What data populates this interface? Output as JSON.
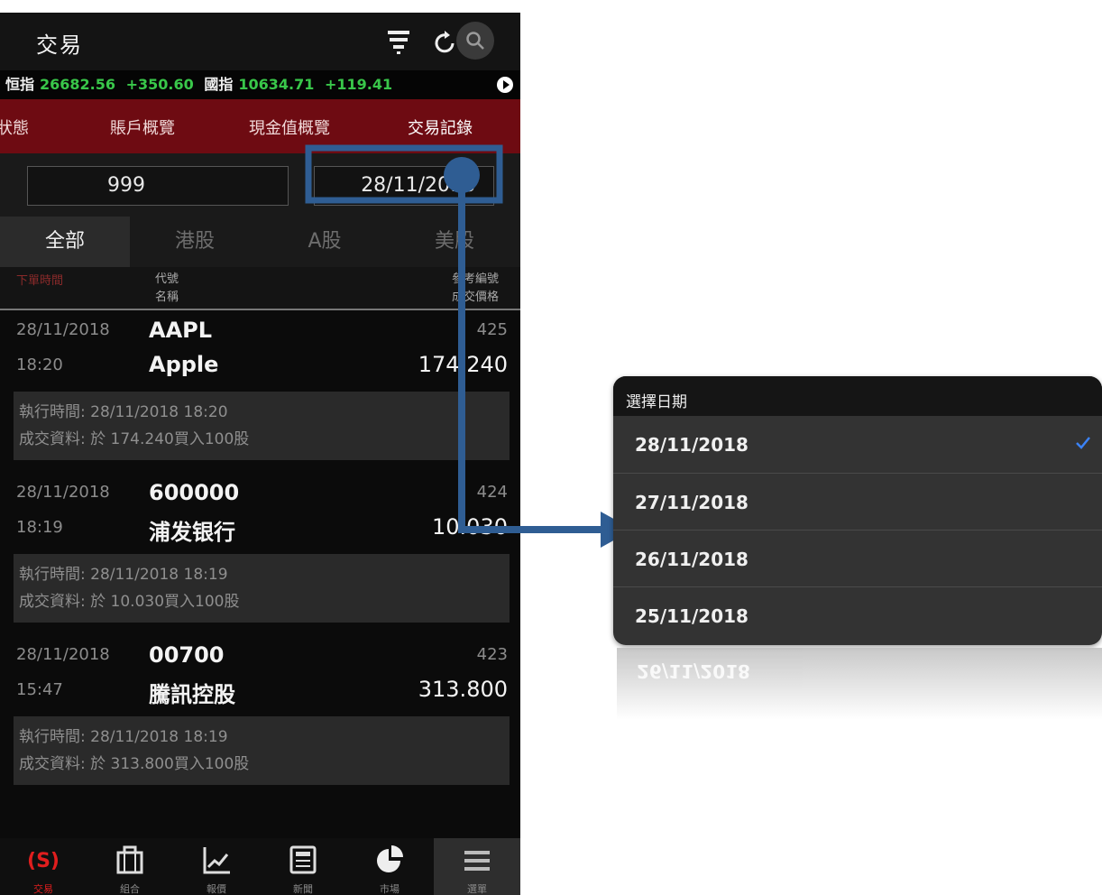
{
  "header": {
    "title": "交易",
    "icons": [
      "filter-icon",
      "refresh-icon",
      "search-icon"
    ]
  },
  "ticker": [
    {
      "name": "恒指",
      "value": "26682.56",
      "change": "+350.60"
    },
    {
      "name": "國指",
      "value": "10634.71",
      "change": "+119.41"
    }
  ],
  "nav_tabs": [
    "狀態",
    "賬戶概覽",
    "現金值概覽",
    "交易記錄"
  ],
  "filters": {
    "account": "999",
    "date": "28/11/2018"
  },
  "market_tabs": [
    "全部",
    "港股",
    "A股",
    "美股"
  ],
  "columns": {
    "order_time": "下單時間",
    "code": "代號",
    "name": "名稱",
    "ref_no": "參考編號",
    "price": "成交價格"
  },
  "trades": [
    {
      "date": "28/11/2018",
      "time": "18:20",
      "code": "AAPL",
      "name": "Apple",
      "ref": "425",
      "price": "174.240",
      "exec": "執行時間:  28/11/2018 18:20",
      "fill": "成交資料: 於  174.240買入100股"
    },
    {
      "date": "28/11/2018",
      "time": "18:19",
      "code": "600000",
      "name": "浦发银行",
      "ref": "424",
      "price": "10.030",
      "exec": "執行時間:  28/11/2018 18:19",
      "fill": "成交資料: 於  10.030買入100股"
    },
    {
      "date": "28/11/2018",
      "time": "15:47",
      "code": "00700",
      "name": "騰訊控股",
      "ref": "423",
      "price": "313.800",
      "exec": "執行時間:  28/11/2018 18:19",
      "fill": "成交資料: 於  313.800買入100股"
    }
  ],
  "bottom_nav": [
    "交易",
    "組合",
    "報價",
    "新聞",
    "市場",
    "選單"
  ],
  "picker": {
    "title": "選擇日期",
    "options": [
      "28/11/2018",
      "27/11/2018",
      "26/11/2018",
      "25/11/2018"
    ],
    "selected": "28/11/2018",
    "reflection": "26/11/2018"
  },
  "colors": {
    "accent_red": "#6e0b12",
    "ticker_green": "#39c74a",
    "annotation_blue": "#2f5d93",
    "check_blue": "#3b82f6"
  }
}
